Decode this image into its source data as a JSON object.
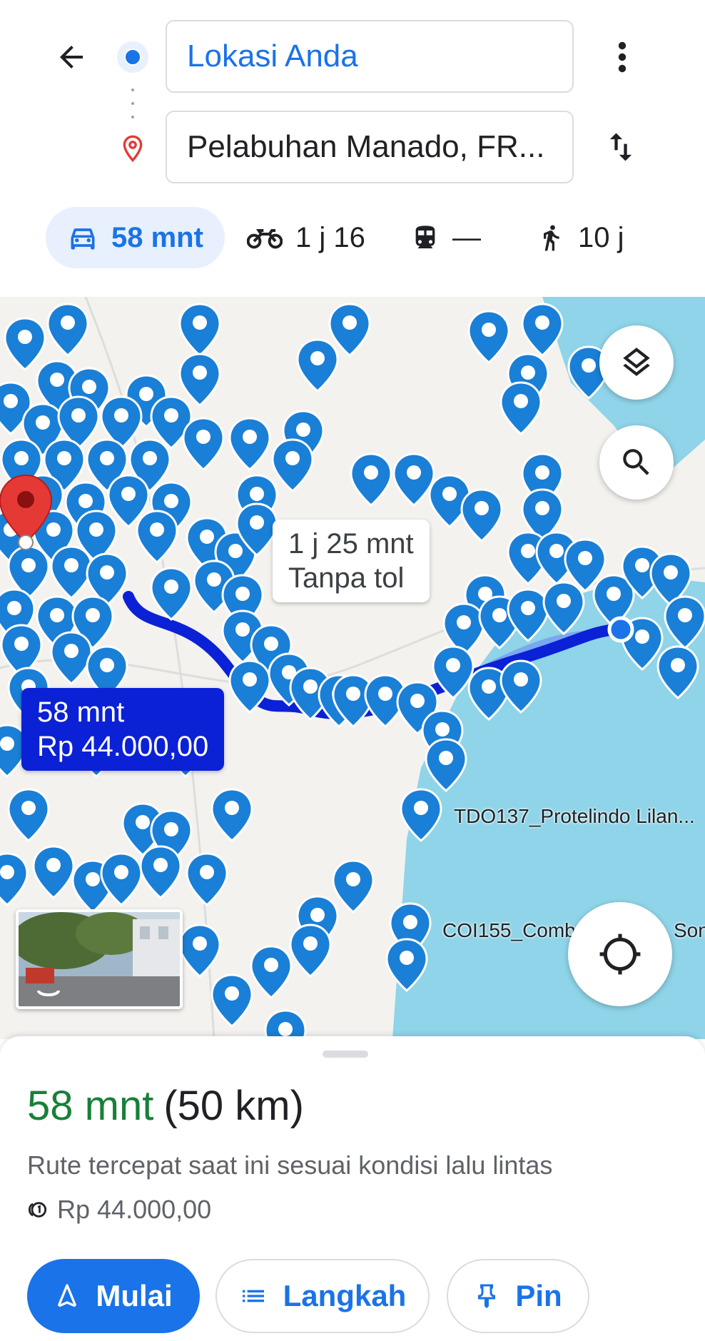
{
  "search": {
    "origin": "Lokasi Anda",
    "destination": "Pelabuhan Manado, FR..."
  },
  "modes": [
    {
      "name": "car",
      "icon": "car-icon",
      "label": "58 mnt",
      "active": true
    },
    {
      "name": "motorcycle",
      "icon": "motorcycle-icon",
      "label": "1 j 16",
      "active": false
    },
    {
      "name": "transit",
      "icon": "train-icon",
      "label": "—",
      "active": false
    },
    {
      "name": "walk",
      "icon": "walk-icon",
      "label": "10 j",
      "active": false
    }
  ],
  "map": {
    "alt_route": {
      "line1": "1 j 25 mnt",
      "line2": "Tanpa tol"
    },
    "main_route": {
      "line1": "58 mnt",
      "line2": "Rp 44.000,00"
    },
    "labels": {
      "tower1": "TDO137_Protelindo Lilan...",
      "tower2": "COI155_Comb",
      "tower2_tail": "Son"
    },
    "colors": {
      "route_main": "#0b21d6",
      "route_alt": "#7aa7f0",
      "sea": "#8fd4e8",
      "land": "#f3f2ef",
      "pin": "#1a7fd6",
      "dest_pin": "#e53935"
    }
  },
  "sheet": {
    "duration": "58 mnt",
    "distance": "(50 km)",
    "description": "Rute tercepat saat ini sesuai kondisi lalu lintas",
    "toll": "Rp 44.000,00",
    "buttons": {
      "start": "Mulai",
      "steps": "Langkah",
      "pin": "Pin"
    }
  }
}
